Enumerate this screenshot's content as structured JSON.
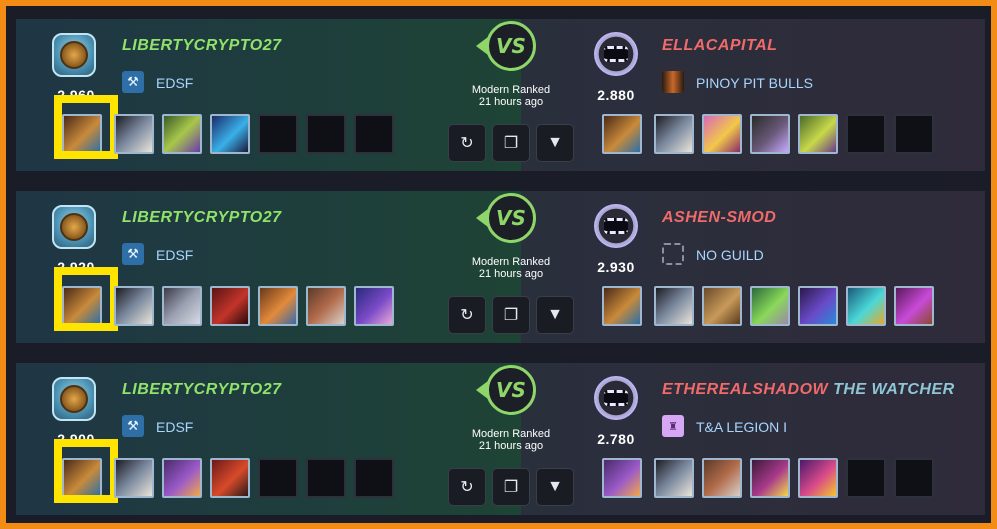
{
  "battles": [
    {
      "player": {
        "name": "LIBERTYCRYPTO27",
        "guild": "EDSF",
        "rating": "2.960"
      },
      "opponent": {
        "name": "ELLACAPITAL",
        "name_suffix": "",
        "guild": "PINOY PIT BULLS",
        "rating": "2.880"
      },
      "vs_label": "VS",
      "format": "Modern Ranked",
      "time": "21 hours ago"
    },
    {
      "player": {
        "name": "LIBERTYCRYPTO27",
        "guild": "EDSF",
        "rating": "2.920"
      },
      "opponent": {
        "name": "ASHEN-SMOD",
        "name_suffix": "",
        "guild": "NO GUILD",
        "rating": "2.930"
      },
      "vs_label": "VS",
      "format": "Modern Ranked",
      "time": "21 hours ago"
    },
    {
      "player": {
        "name": "LIBERTYCRYPTO27",
        "guild": "EDSF",
        "rating": "2.900"
      },
      "opponent": {
        "name": "ETHEREALSHADOW",
        "name_suffix": "THE WATCHER",
        "guild": "T&A LEGION I",
        "rating": "2.780"
      },
      "vs_label": "VS",
      "format": "Modern Ranked",
      "time": "21 hours ago"
    }
  ],
  "icons": {
    "replay": "replay-icon",
    "copy": "copy-icon",
    "expand": "chevron-down-icon"
  },
  "colors": {
    "player_name": "#8fe36a",
    "opponent_name": "#f16a6a",
    "vs": "#8ed66a",
    "highlight": "#ffe400",
    "frame": "#f28c14"
  }
}
